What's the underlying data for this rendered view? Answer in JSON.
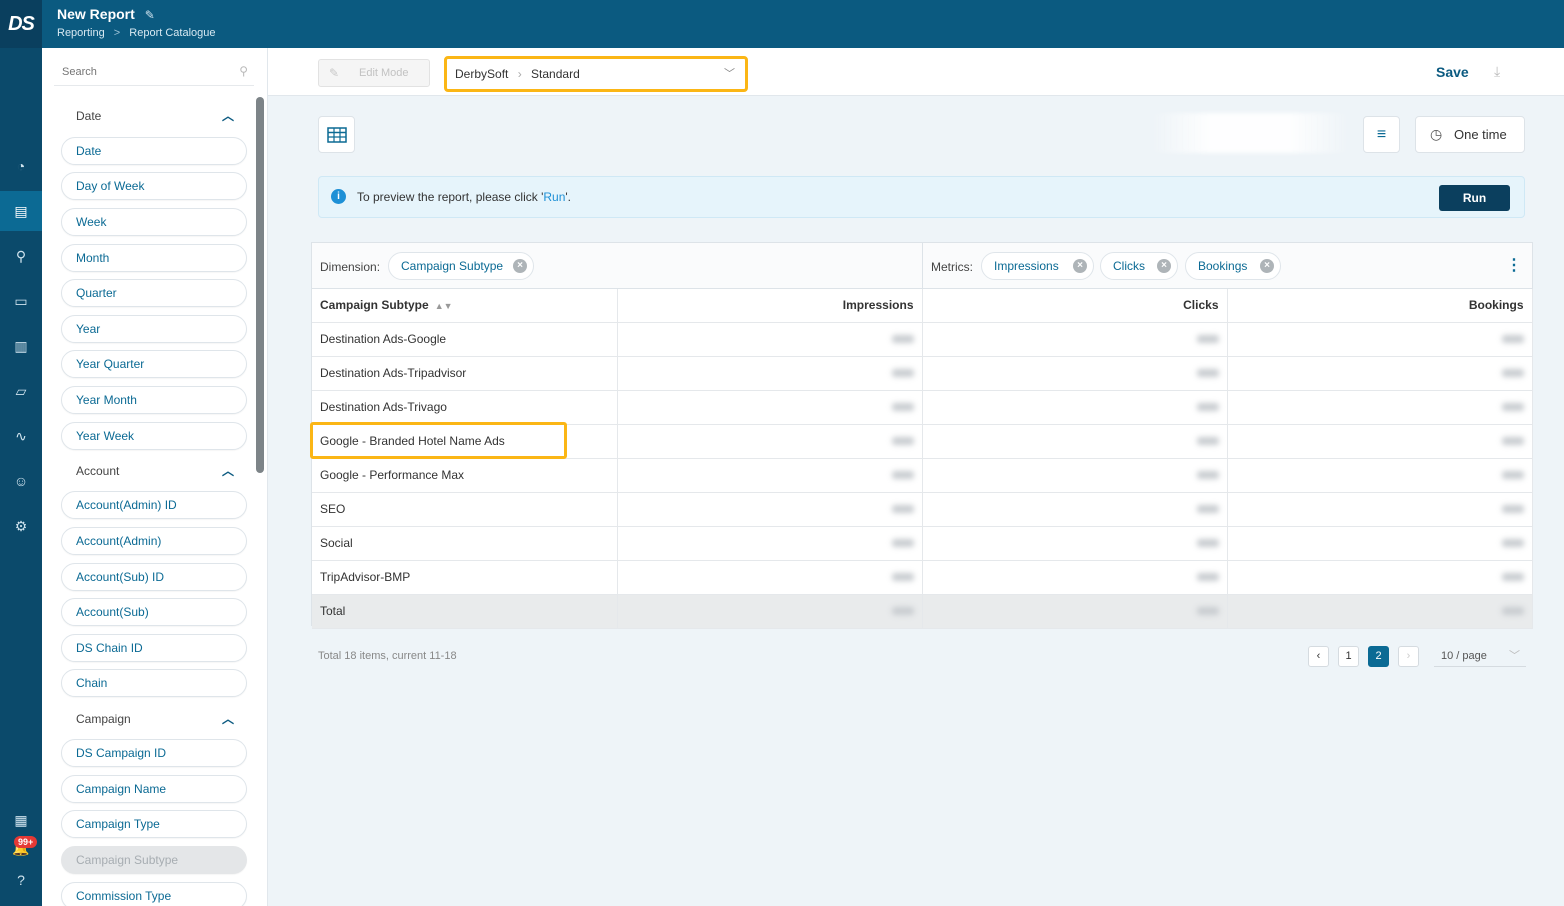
{
  "header": {
    "logo": "DS",
    "title": "New Report",
    "breadcrumb": [
      "Reporting",
      "Report Catalogue"
    ]
  },
  "rail": {
    "icons": [
      "dashboard-icon",
      "report-icon",
      "rocket-icon",
      "wallet-icon",
      "building-icon",
      "folder-icon",
      "activity-icon",
      "user-icon",
      "settings-icon",
      "calculator-icon",
      "notification-icon",
      "help-icon"
    ],
    "active_index": 1,
    "notification_badge": "99+"
  },
  "sidebar": {
    "search_placeholder": "Search",
    "groups": [
      {
        "label": "Date",
        "fields": [
          "Date",
          "Day of Week",
          "Week",
          "Month",
          "Quarter",
          "Year",
          "Year Quarter",
          "Year Month",
          "Year Week"
        ]
      },
      {
        "label": "Account",
        "fields": [
          "Account(Admin) ID",
          "Account(Admin)",
          "Account(Sub) ID",
          "Account(Sub)",
          "DS Chain ID",
          "Chain"
        ]
      },
      {
        "label": "Campaign",
        "fields": [
          "DS Campaign ID",
          "Campaign Name",
          "Campaign Type",
          "Campaign Subtype",
          "Commission Type"
        ]
      }
    ],
    "disabled_field": "Campaign Subtype"
  },
  "toolbar": {
    "edit_mode_label": "Edit Mode",
    "source_path": [
      "DerbySoft",
      "Standard"
    ],
    "save_label": "Save"
  },
  "controls": {
    "one_time_label": "One time"
  },
  "banner": {
    "message_prefix": "To preview the report, please click '",
    "message_link": "Run",
    "message_suffix": "'.",
    "run_label": "Run"
  },
  "report": {
    "dimension_label": "Dimension:",
    "dimensions": [
      "Campaign Subtype"
    ],
    "metrics_label": "Metrics:",
    "metrics": [
      "Impressions",
      "Clicks",
      "Bookings"
    ],
    "columns": [
      "Campaign Subtype",
      "Impressions",
      "Clicks",
      "Bookings"
    ],
    "rows": [
      "Destination Ads-Google",
      "Destination Ads-Tripadvisor",
      "Destination Ads-Trivago",
      "Google - Branded Hotel Name Ads",
      "Google - Performance Max",
      "SEO",
      "Social",
      "TripAdvisor-BMP"
    ],
    "total_label": "Total",
    "highlighted_row": "Google - Branded Hotel Name Ads"
  },
  "pagination": {
    "summary": "Total 18 items, current 11-18",
    "pages": [
      "1",
      "2"
    ],
    "current_page": "2",
    "page_size": "10 / page"
  },
  "colors": {
    "header": "#0b5a80",
    "rail": "#0b4a6b",
    "accent": "#0b6a94",
    "highlight": "#fbb615",
    "run_button": "#0b3f5e"
  }
}
